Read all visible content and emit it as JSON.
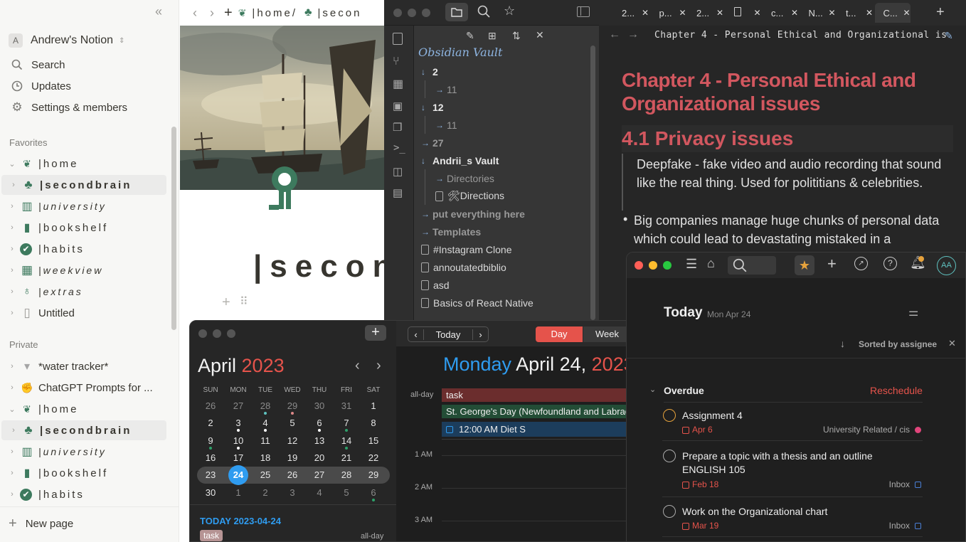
{
  "notion": {
    "workspace": {
      "avatar": "A",
      "name": "Andrew's Notion"
    },
    "menu": [
      {
        "label": "Search",
        "icon": "search-icon"
      },
      {
        "label": "Updates",
        "icon": "clock-icon"
      },
      {
        "label": "Settings & members",
        "icon": "gear-icon"
      }
    ],
    "favorites_label": "Favorites",
    "favorites": [
      {
        "label": "|home",
        "icon": "sprout-icon",
        "style": "spaced"
      },
      {
        "label": "|secondbrain",
        "icon": "brain-tree-icon",
        "style": "spaced-bold"
      },
      {
        "label": "|university",
        "icon": "book-open-icon",
        "style": "italic"
      },
      {
        "label": "|bookshelf",
        "icon": "book-icon",
        "style": "spaced"
      },
      {
        "label": "|habits",
        "icon": "check-circle-icon",
        "style": "spaced"
      },
      {
        "label": "|weekview",
        "icon": "table-icon",
        "style": "italic"
      },
      {
        "label": "|extras",
        "icon": "lightbulb-icon",
        "style": "italic"
      },
      {
        "label": "Untitled",
        "icon": "page-icon",
        "style": "plain"
      }
    ],
    "private_label": "Private",
    "private": [
      {
        "label": "*water tracker*",
        "icon": "cup-icon",
        "style": "plain"
      },
      {
        "label": "ChatGPT Prompts for ...",
        "icon": "arm-icon",
        "style": "plain"
      },
      {
        "label": "|home",
        "icon": "sprout-icon",
        "style": "spaced"
      },
      {
        "label": "|secondbrain",
        "icon": "brain-tree-icon",
        "style": "spaced-bold"
      },
      {
        "label": "|university",
        "icon": "book-open-icon",
        "style": "italic"
      },
      {
        "label": "|bookshelf",
        "icon": "book-icon",
        "style": "spaced"
      },
      {
        "label": "|habits",
        "icon": "check-circle-icon",
        "style": "spaced"
      }
    ],
    "new_page": "New page",
    "breadcrumb": [
      "|home/",
      "|secon"
    ],
    "page_title": "|secon"
  },
  "obsidian": {
    "tabs": [
      "2...",
      "p...",
      "2...",
      "",
      "c...",
      "N...",
      "t...",
      "C..."
    ],
    "vault_name": "Obsidian Vault",
    "tree": [
      {
        "label": "2",
        "kind": "folder-open",
        "indent": 0
      },
      {
        "label": "11",
        "kind": "folder",
        "indent": 1
      },
      {
        "label": "12",
        "kind": "folder-open",
        "indent": 0
      },
      {
        "label": "11",
        "kind": "folder",
        "indent": 1
      },
      {
        "label": "27",
        "kind": "folder",
        "indent": 0
      },
      {
        "label": "Andrii_s Vault",
        "kind": "folder-open",
        "indent": 0
      },
      {
        "label": "Directories",
        "kind": "folder",
        "indent": 1
      },
      {
        "label": "🛠Directions",
        "kind": "file",
        "indent": 1
      },
      {
        "label": "put everything here",
        "kind": "folder",
        "indent": 0
      },
      {
        "label": "Templates",
        "kind": "folder",
        "indent": 0
      },
      {
        "label": "#Instagram Clone",
        "kind": "file",
        "indent": 0
      },
      {
        "label": "annoutatedbiblio",
        "kind": "file",
        "indent": 0
      },
      {
        "label": "asd",
        "kind": "file",
        "indent": 0
      },
      {
        "label": "Basics of React Native",
        "kind": "file",
        "indent": 0
      }
    ],
    "note_title_bar": "Chapter 4 - Personal Ethical and Organizational is",
    "h1": "Chapter 4 - Personal Ethical and Organizational issues",
    "h2": "4.1 Privacy issues",
    "para1": "Deepfake - fake video and audio recording that sound like the real thing. Used for polititians & celebrities.",
    "bullet1": "Big companies manage huge chunks of personal data which could lead to devastating mistaked in a"
  },
  "calendar": {
    "month": "April",
    "year": "2023",
    "weekdays": [
      "SUN",
      "MON",
      "TUE",
      "WED",
      "THU",
      "FRI",
      "SAT"
    ],
    "weeks": [
      [
        "26",
        "27",
        "28",
        "29",
        "30",
        "31",
        "1"
      ],
      [
        "2",
        "3",
        "4",
        "5",
        "6",
        "7",
        "8"
      ],
      [
        "9",
        "10",
        "11",
        "12",
        "13",
        "14",
        "15"
      ],
      [
        "16",
        "17",
        "18",
        "19",
        "20",
        "21",
        "22"
      ],
      [
        "23",
        "24",
        "25",
        "26",
        "27",
        "28",
        "29"
      ],
      [
        "30",
        "1",
        "2",
        "3",
        "4",
        "5",
        "6"
      ]
    ],
    "today_btn": "Today",
    "view_day": "Day",
    "view_week": "Week",
    "header_weekday": "Monday",
    "header_date": "April 24,",
    "header_year": "2023",
    "allday_label": "all-day",
    "allday_events": [
      "task",
      "St. George's Day (Newfoundland and Labrador)"
    ],
    "timed_event_time": "12:00 AM",
    "timed_event_title": "Diet S",
    "hours": [
      "1 AM",
      "2 AM",
      "3 AM"
    ],
    "today_label": "TODAY 2023-04-24",
    "today_task": "task",
    "today_allday": "all-day"
  },
  "todoist": {
    "avatar": "AA",
    "title": "Today",
    "date": "Mon Apr 24",
    "sorted": "Sorted by assignee",
    "section": "Overdue",
    "reschedule": "Reschedule",
    "tasks": [
      {
        "title": "Assignment 4",
        "date": "Apr 6",
        "project": "University Related / cis"
      },
      {
        "title": "Prepare a topic with a thesis and an outline ENGLISH 105",
        "date": "Feb 18",
        "project": "Inbox"
      },
      {
        "title": "Work on the Organizational chart",
        "date": "Mar 19",
        "project": "Inbox"
      }
    ]
  },
  "colors": {
    "accent_red": "#d64f4f",
    "obs_heading": "#d2575f",
    "cal_blue": "#2f9cf0",
    "notion_green": "#3d7a5e",
    "todoist_orange": "#e6a23c"
  }
}
